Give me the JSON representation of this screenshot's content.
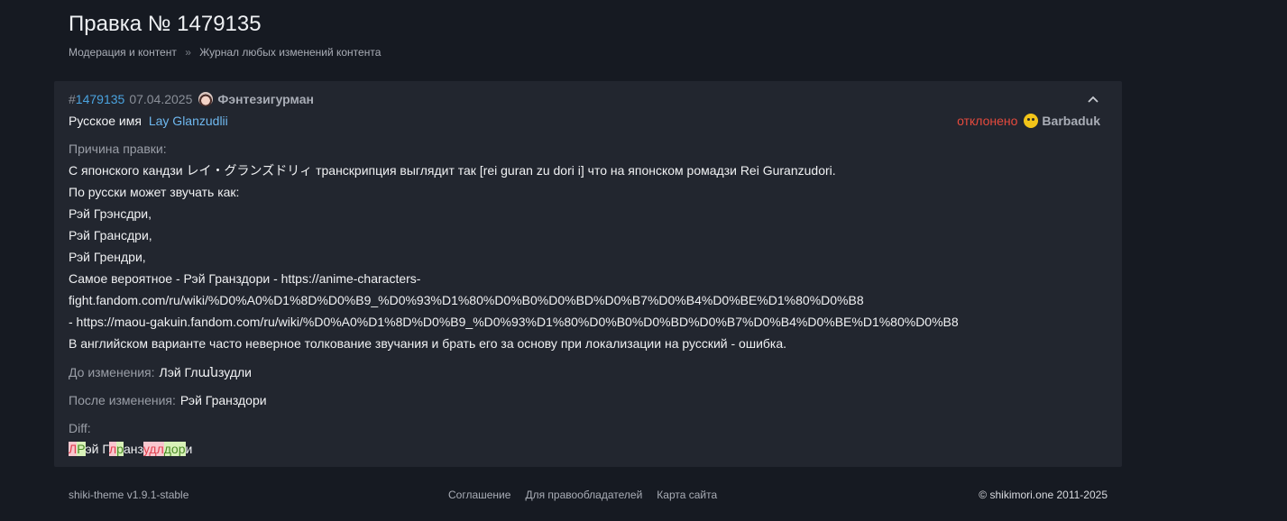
{
  "page": {
    "title": "Правка № 1479135",
    "breadcrumb": [
      "Модерация и контент",
      "Журнал любых изменений контента"
    ],
    "breadcrumb_separator": "»"
  },
  "version": {
    "hash": "#",
    "id": "1479135",
    "date": "07.04.2025",
    "author": "Фэнтезигурман",
    "field_name": "Русское имя",
    "field_target": "Lay Glanzudlii",
    "status": "отклонено",
    "moderator": "Barbaduk",
    "reason_label": "Причина правки:",
    "reason_lines": [
      "С японского кандзи レイ・グランズドリィ транскрипция выглядит так [rei guran zu dori i] что на японском ромадзи Rei Guranzudori.",
      "По русски может звучать как:",
      "Рэй Грэнсдри,",
      "Рэй Грансдри,",
      "Рэй Грендри,",
      "Самое вероятное - Рэй Гранздори - https://anime-characters-",
      "fight.fandom.com/ru/wiki/%D0%A0%D1%8D%D0%B9_%D0%93%D1%80%D0%B0%D0%BD%D0%B7%D0%B4%D0%BE%D1%80%D0%B8",
      "- https://maou-gakuin.fandom.com/ru/wiki/%D0%A0%D1%8D%D0%B9_%D0%93%D1%80%D0%B0%D0%BD%D0%B7%D0%B4%D0%BE%D1%80%D0%B8",
      "В английском варианте часто неверное толкование звучания и брать его за основу при локализации на русский - ошибка."
    ],
    "before_label": "До изменения:",
    "before_value": "Лэй Глանзудли",
    "after_label": "После изменения:",
    "after_value": "Рэй Гранздори",
    "diff_label": "Diff:",
    "diff": [
      {
        "t": "del",
        "text": "Л"
      },
      {
        "t": "ins",
        "text": "Р"
      },
      {
        "t": "eq",
        "text": "эй Г"
      },
      {
        "t": "del",
        "text": "л"
      },
      {
        "t": "ins",
        "text": "р"
      },
      {
        "t": "eq",
        "text": "анз"
      },
      {
        "t": "del",
        "text": "удл"
      },
      {
        "t": "ins",
        "text": "дор"
      },
      {
        "t": "eq",
        "text": "и"
      }
    ]
  },
  "footer": {
    "version": "shiki-theme v1.9.1-stable",
    "links": [
      "Соглашение",
      "Для правообладателей",
      "Карта сайта"
    ],
    "copyright": "© shikimori.one 2011-2025"
  },
  "colors": {
    "background": "#161a22",
    "card": "#22262f",
    "link": "#4aa3df",
    "rejected": "#e64a3d"
  }
}
